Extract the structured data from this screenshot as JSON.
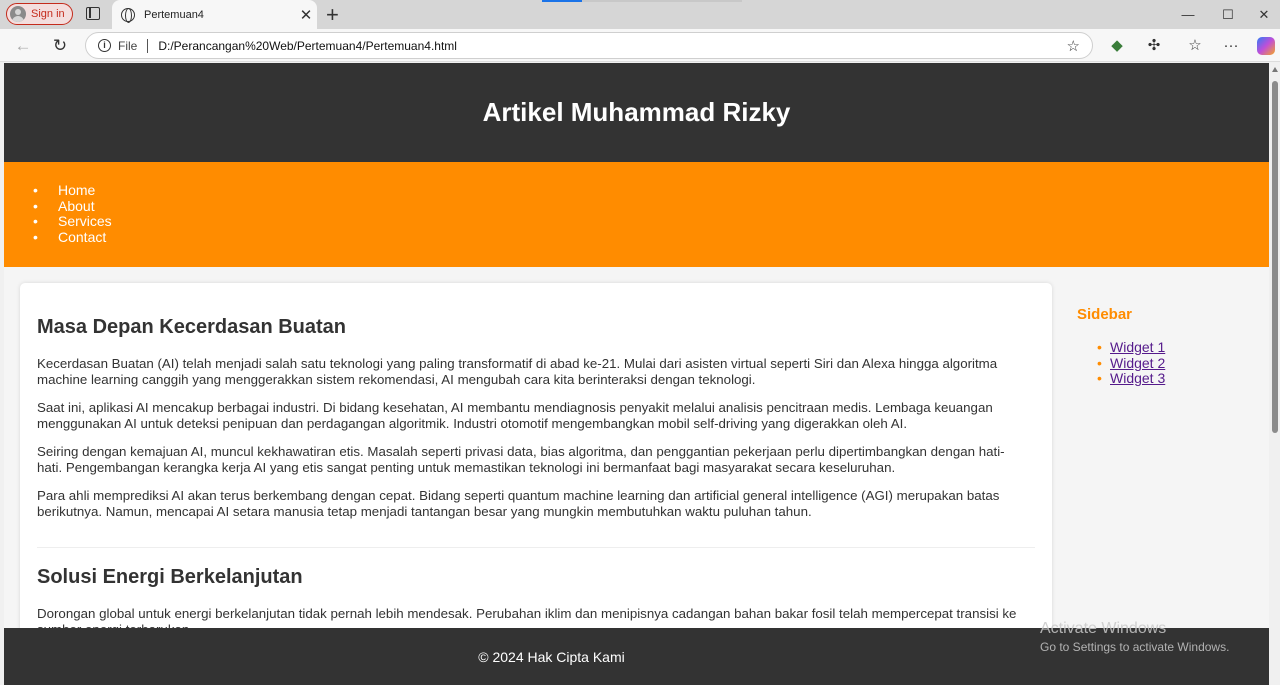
{
  "browser": {
    "signin_label": "Sign in",
    "tab_title": "Pertemuan4",
    "tab_close": "✕",
    "new_tab": "+",
    "address_scheme": "File",
    "address_url": "D:/Perancangan%20Web/Pertemuan4/Pertemuan4.html",
    "minimize": "—",
    "maximize": "☐",
    "close": "✕",
    "back": "←",
    "reload": "↻",
    "favorite": "☆",
    "more": "···"
  },
  "page": {
    "header_title": "Artikel Muhammad Rizky",
    "nav": [
      "Home",
      "About",
      "Services",
      "Contact"
    ],
    "articles": [
      {
        "title": "Masa Depan Kecerdasan Buatan",
        "paragraphs": [
          "Kecerdasan Buatan (AI) telah menjadi salah satu teknologi yang paling transformatif di abad ke-21. Mulai dari asisten virtual seperti Siri dan Alexa hingga algoritma machine learning canggih yang menggerakkan sistem rekomendasi, AI mengubah cara kita berinteraksi dengan teknologi.",
          "Saat ini, aplikasi AI mencakup berbagai industri. Di bidang kesehatan, AI membantu mendiagnosis penyakit melalui analisis pencitraan medis. Lembaga keuangan menggunakan AI untuk deteksi penipuan dan perdagangan algoritmik. Industri otomotif mengembangkan mobil self-driving yang digerakkan oleh AI.",
          "Seiring dengan kemajuan AI, muncul kekhawatiran etis. Masalah seperti privasi data, bias algoritma, dan penggantian pekerjaan perlu dipertimbangkan dengan hati-hati. Pengembangan kerangka kerja AI yang etis sangat penting untuk memastikan teknologi ini bermanfaat bagi masyarakat secara keseluruhan.",
          "Para ahli memprediksi AI akan terus berkembang dengan cepat. Bidang seperti quantum machine learning dan artificial general intelligence (AGI) merupakan batas berikutnya. Namun, mencapai AI setara manusia tetap menjadi tantangan besar yang mungkin membutuhkan waktu puluhan tahun."
        ]
      },
      {
        "title": "Solusi Energi Berkelanjutan",
        "paragraphs": [
          "Dorongan global untuk energi berkelanjutan tidak pernah lebih mendesak. Perubahan iklim dan menipisnya cadangan bahan bakar fosil telah mempercepat transisi ke sumber energi terbarukan."
        ]
      }
    ],
    "sidebar": {
      "title": "Sidebar",
      "widgets": [
        "Widget 1",
        "Widget 2",
        "Widget 3"
      ]
    },
    "footer": "© 2024 Hak Cipta Kami"
  },
  "watermark": {
    "line1": "Activate Windows",
    "line2": "Go to Settings to activate Windows."
  }
}
